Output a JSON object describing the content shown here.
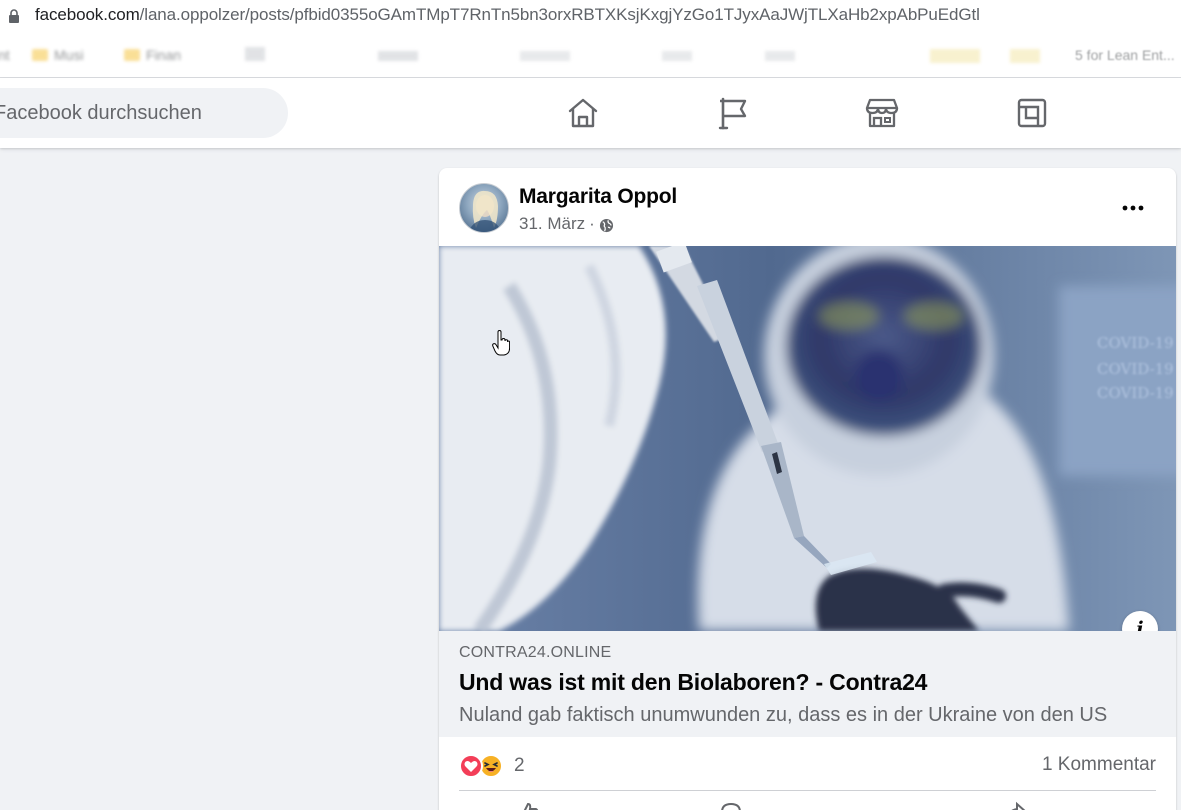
{
  "browser": {
    "url_domain": "facebook.com",
    "url_path": "/lana.oppolzer/posts/pfbid0355oGAmTMpT7RnTn5bn3orxRBTXKsjKxgjYzGo1TJyxAaJWjTLXaHb2xpAbPuEdGtl",
    "bookmarks": [
      {
        "label": "nt"
      },
      {
        "label": "Musi"
      },
      {
        "label": "Finan"
      },
      {
        "label": "5 for Lean Ent..."
      }
    ]
  },
  "fb_nav": {
    "search_placeholder": "Facebook durchsuchen",
    "icons": [
      "home-icon",
      "pages-icon",
      "marketplace-icon",
      "gaming-icon"
    ]
  },
  "post": {
    "author": "Margarita Oppol",
    "date": "31. März",
    "separator": "·",
    "privacy_icon": "globe-icon",
    "link": {
      "domain": "CONTRA24.ONLINE",
      "title": "Und was ist mit den Biolaboren? - Contra24",
      "description": "Nuland gab faktisch unumwunden zu, dass es in der Ukraine von den US"
    },
    "photo_text": [
      "COVID-19",
      "COVID-19",
      "COVID-19"
    ],
    "reactions": {
      "types": [
        "love",
        "haha"
      ],
      "count": "2"
    },
    "comment_count": "1 Kommentar"
  },
  "colors": {
    "fb_background": "#f0f2f5",
    "text_primary": "#050505",
    "text_secondary": "#65676b",
    "love": "#f33e58",
    "haha": "#f7b125"
  }
}
